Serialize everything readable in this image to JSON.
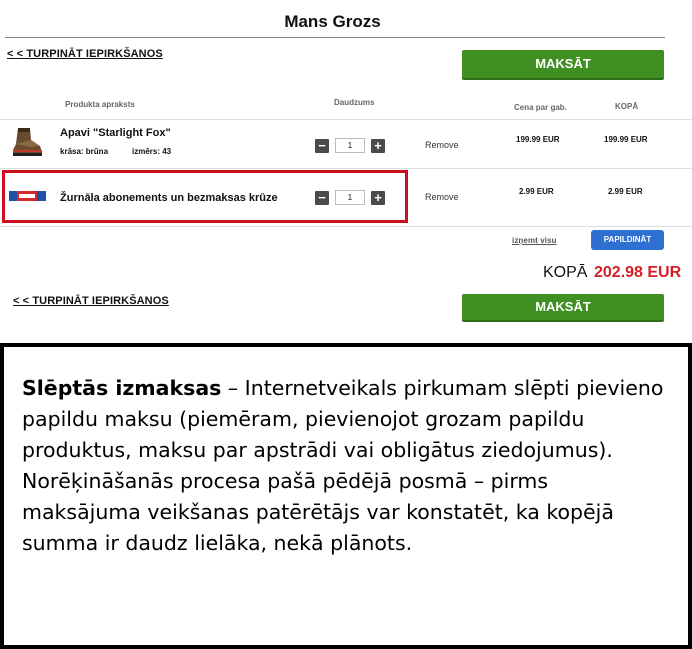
{
  "cart": {
    "title": "Mans Grozs",
    "continue_top": "< < TURPINĀT IEPIRKŠANOS",
    "continue_bottom": "< < TURPINĀT IEPIRKŠANOS",
    "pay_label": "MAKSĀT",
    "columns": {
      "description": "Produkta apraksts",
      "quantity": "Daudzums",
      "unit_price": "Cena par gab.",
      "total": "KOPĀ"
    },
    "items": [
      {
        "name": "Apavi \"Starlight Fox\"",
        "color_label": "krāsa: brūna",
        "size_label": "izmērs: 43",
        "qty": "1",
        "remove": "Remove",
        "unit_price": "199.99 EUR",
        "total": "199.99 EUR",
        "icon": "boot-icon"
      },
      {
        "name": "Žurnāla abonements un bezmaksas krūze",
        "qty": "1",
        "remove": "Remove",
        "unit_price": "2.99 EUR",
        "total": "2.99 EUR",
        "icon": "magazine-logo-icon"
      }
    ],
    "clear_all": "izņemt visu",
    "update_label": "PAPILDINĀT",
    "grand_total_label": "KOPĀ",
    "grand_total_value": "202.98 EUR",
    "colors": {
      "pay_green": "#3f8f22",
      "update_blue": "#2f6fd1",
      "total_red": "#d41f28",
      "highlight_red": "#cc0f1c"
    }
  },
  "note": {
    "term": "Slēptās izmaksas",
    "text": " – Internetveikals pirkumam slēpti pievieno papildu maksu (piemēram, pievienojot grozam papildu produktus, maksu par apstrādi vai obligātus ziedojumus). Norēķināšanās procesa pašā pēdējā posmā – pirms maksājuma veikšanas patērētājs var konstatēt, ka kopējā summa ir daudz lielāka, nekā plānots."
  }
}
